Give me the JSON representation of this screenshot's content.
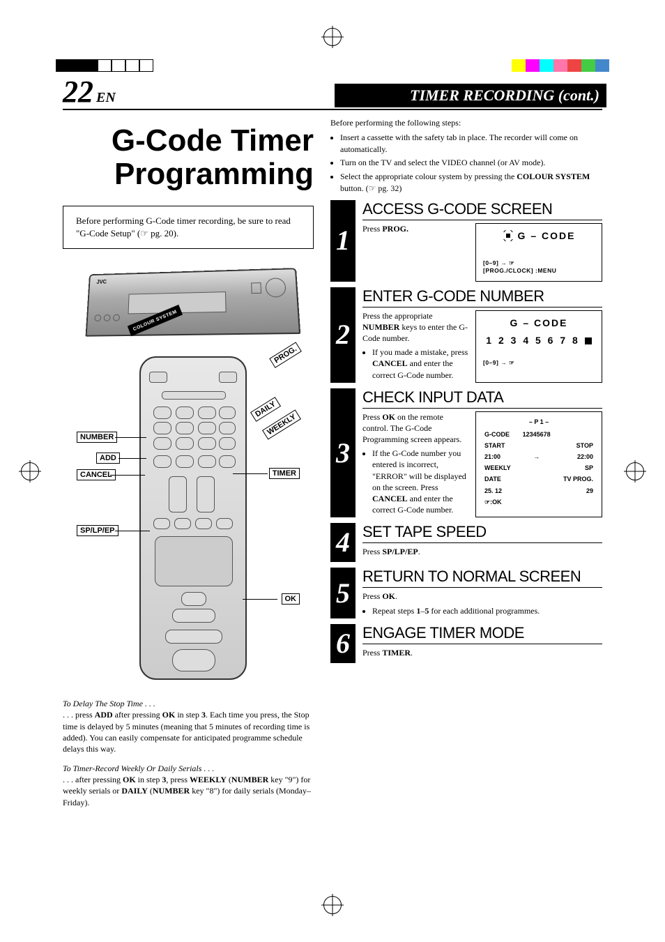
{
  "header": {
    "page_number": "22",
    "lang_code": "EN",
    "section_title": "TIMER RECORDING (cont.)"
  },
  "left": {
    "main_title_line1": "G-Code Timer",
    "main_title_line2": "Programming",
    "intro_box": "Before performing G-Code timer recording, be sure to read \"G-Code Setup\" (☞ pg. 20).",
    "vcr_ribbon_label": "COLOUR SYSTEM",
    "vcr_brand": "JVC",
    "remote_labels": {
      "prog": "PROG.",
      "daily": "DAILY",
      "weekly": "WEEKLY",
      "number": "NUMBER",
      "add": "ADD",
      "cancel": "CANCEL",
      "timer": "TIMER",
      "sp_lp_ep": "SP/LP/EP",
      "ok": "OK"
    },
    "tips": {
      "delay_heading": "To Delay The Stop Time . . .",
      "delay_body": ". . . press ADD after pressing OK in step 3. Each time you press, the Stop time is delayed by 5 minutes (meaning that 5 minutes of recording time is added). You can easily compensate for anticipated programme schedule delays this way.",
      "serials_heading": "To Timer-Record Weekly Or Daily Serials . . .",
      "serials_body": ". . . after pressing OK in step 3, press WEEKLY (NUMBER key \"9\") for weekly serials or DAILY (NUMBER key \"8\") for daily serials (Monday–Friday)."
    }
  },
  "right": {
    "pre_intro": "Before performing the following steps:",
    "pre_bullets": [
      "Insert a cassette with the safety tab in place. The recorder will come on automatically.",
      "Turn on the TV and select the VIDEO channel (or AV mode).",
      "Select the appropriate colour system by pressing the COLOUR SYSTEM button. (☞ pg. 32)"
    ],
    "steps": [
      {
        "num": "1",
        "title": "ACCESS G-CODE SCREEN",
        "body_html": "Press <strong>PROG.</strong>",
        "osd": {
          "title": "G – CODE",
          "hints": [
            "[0–9] → ☞",
            "[PROG./CLOCK] :MENU"
          ],
          "show_icon": true
        }
      },
      {
        "num": "2",
        "title": "ENTER G-CODE NUMBER",
        "body_html": "Press the appropriate <strong>NUMBER</strong> keys to enter the G-Code number.",
        "bullet_html": "If you made a mistake, press <strong>CANCEL</strong> and enter the correct G-Code number.",
        "osd": {
          "title": "G – CODE",
          "code": "1 2 3 4 5 6 7 8",
          "hints": [
            "[0–9] → ☞"
          ],
          "show_stop_icon": true
        }
      },
      {
        "num": "3",
        "title": "CHECK INPUT DATA",
        "body_html": "Press <strong>OK</strong> on the remote control. The G-Code Programming screen appears.",
        "bullet_html": "If the G-Code number you entered is incorrect, \"ERROR\" will be displayed on the screen. Press <strong>CANCEL</strong> and enter the correct G-Code number.",
        "osd_table": {
          "header": "– P 1 –",
          "rows": [
            [
              "G-CODE",
              "12345678",
              ""
            ],
            [
              "START",
              "",
              "STOP"
            ],
            [
              "21:00",
              "→",
              "22:00"
            ],
            [
              "WEEKLY",
              "",
              "SP"
            ],
            [
              "DATE",
              "",
              "TV PROG."
            ],
            [
              "25. 12",
              "",
              "29"
            ],
            [
              "☞:OK",
              "",
              ""
            ]
          ]
        }
      },
      {
        "num": "4",
        "title": "SET TAPE SPEED",
        "body_html": "Press <strong>SP/LP/EP</strong>."
      },
      {
        "num": "5",
        "title": "RETURN TO NORMAL SCREEN",
        "body_html": "Press <strong>OK</strong>.",
        "bullet_html": "Repeat steps <strong>1</strong>–<strong>5</strong> for each additional programmes."
      },
      {
        "num": "6",
        "title": "ENGAGE TIMER MODE",
        "body_html": "Press <strong>TIMER</strong>."
      }
    ]
  }
}
